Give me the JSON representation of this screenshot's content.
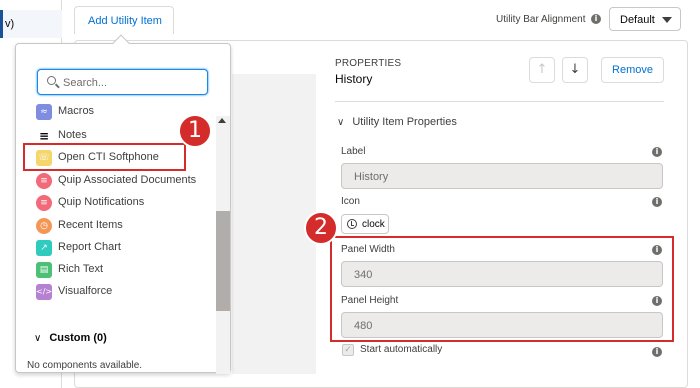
{
  "left_strip": {
    "text": "v)"
  },
  "header": {
    "add_utility_item": "Add Utility Item",
    "alignment_label": "Utility Bar Alignment",
    "alignment_value": "Default"
  },
  "properties": {
    "heading": "PROPERTIES",
    "title": "History",
    "remove_label": "Remove",
    "section_label": "Utility Item Properties",
    "label_label": "Label",
    "label_value": "History",
    "icon_label": "Icon",
    "icon_value": "clock",
    "panel_width_label": "Panel Width",
    "panel_width_value": "340",
    "panel_height_label": "Panel Height",
    "panel_height_value": "480",
    "start_auto_label": "Start automatically"
  },
  "popover": {
    "search_placeholder": "Search...",
    "items": [
      {
        "label": "Macros",
        "icon": "macros-icon",
        "color": "#7f8de1"
      },
      {
        "label": "Notes",
        "icon": "notes-icon",
        "color": "#080707"
      },
      {
        "label": "Open CTI Softphone",
        "icon": "phone-icon",
        "color": "#f4d66c"
      },
      {
        "label": "Quip Associated Documents",
        "icon": "quip-icon",
        "color": "#f26979"
      },
      {
        "label": "Quip Notifications",
        "icon": "quip-icon",
        "color": "#f26979"
      },
      {
        "label": "Recent Items",
        "icon": "clock-icon",
        "color": "#f49756"
      },
      {
        "label": "Report Chart",
        "icon": "chart-icon",
        "color": "#2ecbbe"
      },
      {
        "label": "Rich Text",
        "icon": "richtext-icon",
        "color": "#4bc076"
      },
      {
        "label": "Visualforce",
        "icon": "code-icon",
        "color": "#b781d3"
      }
    ],
    "custom_label": "Custom (0)",
    "empty_message": "No components available."
  },
  "callouts": {
    "one": "1",
    "two": "2"
  },
  "colors": {
    "accent": "#0070d2",
    "callout": "#d42b2b"
  }
}
